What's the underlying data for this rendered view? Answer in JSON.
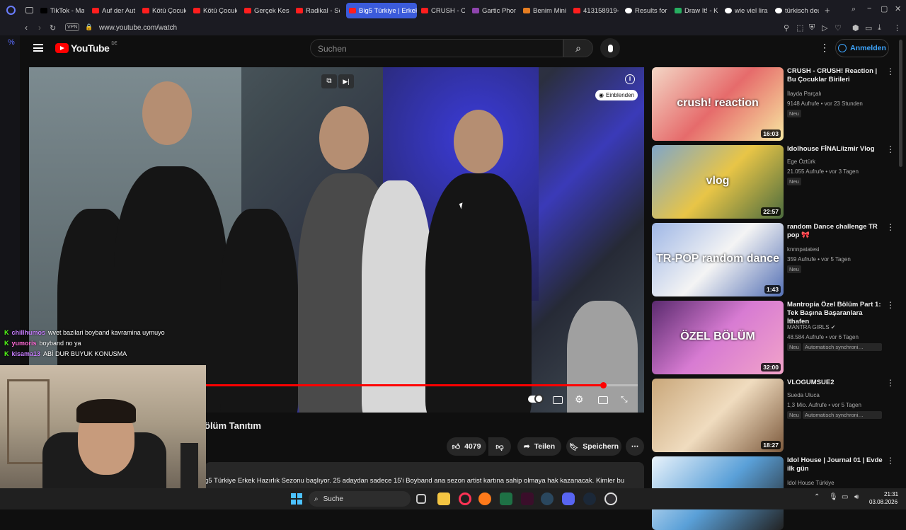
{
  "tabs": [
    {
      "label": "TikTok - Ma"
    },
    {
      "label": "Auf der Aut"
    },
    {
      "label": "Kötü Çocuk"
    },
    {
      "label": "Kötü Çocuk"
    },
    {
      "label": "Gerçek Kes"
    },
    {
      "label": "Radikal - Sö"
    },
    {
      "label": "Big5 Türkiye | Erkek"
    },
    {
      "label": "CRUSH - CR"
    },
    {
      "label": "Gartic Phon"
    },
    {
      "label": "Benim Mini"
    },
    {
      "label": "413158919-"
    },
    {
      "label": "Results for"
    },
    {
      "label": "Draw It! - K"
    },
    {
      "label": "wie viel lira"
    },
    {
      "label": "türkisch deu"
    }
  ],
  "address": {
    "vpn": "VPN",
    "url": "www.youtube.com/watch"
  },
  "yt": {
    "logo": "YouTube",
    "region": "DE",
    "search_placeholder": "Suchen",
    "signin": "Anmelden"
  },
  "video": {
    "einblenden": "Einblenden",
    "title_fragment": "ölüm Tanıtım",
    "progress": 0.92
  },
  "actions": {
    "likes": "4079",
    "share": "Teilen",
    "save": "Speichern"
  },
  "description": "g5 Türkiye Erkek Hazırlık Sezonu başlıyor. 25 adaydan sadece 15'i Boyband ana sezon artist kartına sahip olmaya hak kazanacak. Kimler bu",
  "chat": [
    {
      "user": "chillhumos",
      "color": "#c77dff",
      "text": "wvet bazilari boyband kavramina uymuyo"
    },
    {
      "user": "yumoris",
      "color": "#ff6bd6",
      "text": "boyband no ya"
    },
    {
      "user": "kisama13",
      "color": "#c77dff",
      "text": "ABİ DUR BUYUK KONUSMA"
    }
  ],
  "recs": [
    {
      "title": "CRUSH - CRUSH! Reaction | Bu Çocuklar Birileri",
      "channel": "İlayda Parçalı",
      "meta": "9148 Aufrufe • vor 23 Stunden",
      "badge": "Neu",
      "badge2": "",
      "duration": "16:03",
      "thumb_text": "crush! reaction"
    },
    {
      "title": "Idolhouse FİNAL/izmir Vlog",
      "channel": "Ege Öztürk",
      "meta": "21.055 Aufrufe • vor 3 Tagen",
      "badge": "Neu",
      "badge2": "",
      "duration": "22:57",
      "thumb_text": "vlog"
    },
    {
      "title": "random Dance challenge TR pop 🎀",
      "channel": "knnnpatatesi",
      "meta": "359 Aufrufe • vor 5 Tagen",
      "badge": "Neu",
      "badge2": "",
      "duration": "1:43",
      "thumb_text": "TR-POP random dance"
    },
    {
      "title": "Mantropia Özel Bölüm Part 1: Tek Başına Başaranlara İthafen",
      "channel": "MANTRA GIRLS ✔",
      "meta": "48.584 Aufrufe • vor 6 Tagen",
      "badge": "Neu",
      "badge2": "Automatisch synchroni…",
      "duration": "32:00",
      "thumb_text": "ÖZEL BÖLÜM"
    },
    {
      "title": "VLOGUMSUE2",
      "channel": "Sueda Uluca",
      "meta": "1,3 Mio. Aufrufe • vor 5 Tagen",
      "badge": "Neu",
      "badge2": "Automatisch synchroni…",
      "duration": "18:27",
      "thumb_text": ""
    },
    {
      "title": "Idol House | Journal 01 | Evde ilk gün",
      "channel": "Idol House Türkiye",
      "meta": "",
      "badge": "",
      "badge2": "",
      "duration": "",
      "thumb_text": ""
    }
  ],
  "taskbar": {
    "search": "Suche",
    "time": "21:31",
    "date": "03.08.2026"
  },
  "colors": {
    "accent": "#ff0000",
    "link": "#3ea6ff",
    "active_tab": "#3b5bdb"
  }
}
